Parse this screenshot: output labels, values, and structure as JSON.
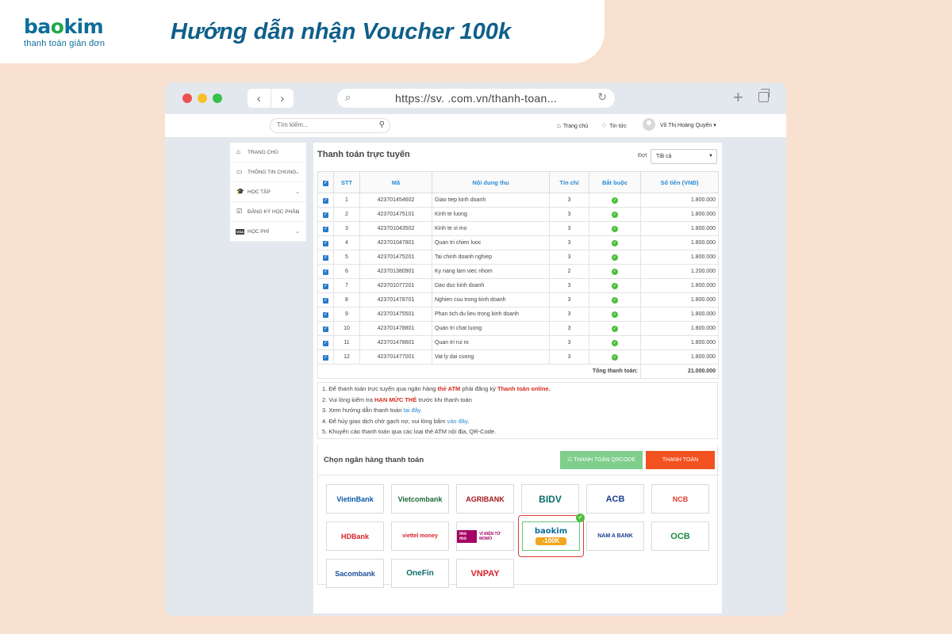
{
  "banner": {
    "logo_main_a": "ba",
    "logo_main_o": "o",
    "logo_main_b": "kim",
    "logo_sub": "thanh toán giản đơn",
    "title": "Hướng dẫn nhận Voucher 100k"
  },
  "browser": {
    "url": "https://sv.        .com.vn/thanh-toan...",
    "back_glyph": "‹",
    "forward_glyph": "›",
    "new_tab_glyph": "+",
    "reload_glyph": "↻",
    "search_glyph": "⌕"
  },
  "topbar": {
    "search_placeholder": "Tìm kiếm...",
    "home_label": "Trang chủ",
    "news_label": "Tin tức",
    "user_name": "Võ Thị Hoàng Quyên ▾"
  },
  "sidebar": {
    "items": [
      {
        "label": "TRANG CHỦ",
        "icon": "home-icon",
        "glyph": "⌂",
        "chevron": ""
      },
      {
        "label": "THÔNG TIN CHUNG",
        "icon": "monitor-icon",
        "glyph": "▭",
        "chevron": "⌄"
      },
      {
        "label": "HỌC TẬP",
        "icon": "graduation-cap-icon",
        "glyph": "🎓",
        "chevron": "⌄"
      },
      {
        "label": "ĐĂNG KÝ HỌC PHẦN",
        "icon": "checkbox-icon",
        "glyph": "☑",
        "chevron": "⌄"
      },
      {
        "label": "HỌC PHÍ",
        "icon": "visa-card-icon",
        "glyph": "VISA",
        "chevron": "⌄"
      }
    ]
  },
  "content": {
    "title": "Thanh toán trực tuyến",
    "filter_label": "Đợt",
    "filter_value": "Tất cả",
    "headers": [
      "STT",
      "Mã",
      "Nội dung thu",
      "Tín chỉ",
      "Bắt buộc",
      "Số tiền (VNĐ)"
    ],
    "rows": [
      {
        "stt": "1",
        "ma": "423701454602",
        "noi_dung": "Giao tiep kinh doanh",
        "tin_chi": "3",
        "so_tien": "1.800.000"
      },
      {
        "stt": "2",
        "ma": "423701475101",
        "noi_dung": "Kinh te luong",
        "tin_chi": "3",
        "so_tien": "1.800.000"
      },
      {
        "stt": "3",
        "ma": "423701043502",
        "noi_dung": "Kinh te vi mo",
        "tin_chi": "3",
        "so_tien": "1.800.000"
      },
      {
        "stt": "4",
        "ma": "423701047801",
        "noi_dung": "Quan tri chien luoc",
        "tin_chi": "3",
        "so_tien": "1.800.000"
      },
      {
        "stt": "5",
        "ma": "423701475201",
        "noi_dung": "Tai chinh doanh nghiep",
        "tin_chi": "3",
        "so_tien": "1.800.000"
      },
      {
        "stt": "6",
        "ma": "423701380901",
        "noi_dung": "Ky nang lam viec nhom",
        "tin_chi": "2",
        "so_tien": "1.200.000"
      },
      {
        "stt": "7",
        "ma": "423701077201",
        "noi_dung": "Dao duc kinh doanh",
        "tin_chi": "3",
        "so_tien": "1.800.000"
      },
      {
        "stt": "8",
        "ma": "423701478701",
        "noi_dung": "Nghien cuu trong kinh doanh",
        "tin_chi": "3",
        "so_tien": "1.800.000"
      },
      {
        "stt": "9",
        "ma": "423701475501",
        "noi_dung": "Phan tich du lieu trong kinh doanh",
        "tin_chi": "3",
        "so_tien": "1.800.000"
      },
      {
        "stt": "10",
        "ma": "423701478801",
        "noi_dung": "Quan tri chat luong",
        "tin_chi": "3",
        "so_tien": "1.800.000"
      },
      {
        "stt": "11",
        "ma": "423701478601",
        "noi_dung": "Quan tri rui ro",
        "tin_chi": "3",
        "so_tien": "1.800.000"
      },
      {
        "stt": "12",
        "ma": "423701477001",
        "noi_dung": "Vat ly dai cuong",
        "tin_chi": "3",
        "so_tien": "1.800.000"
      }
    ],
    "total_label": "Tổng thanh toán:",
    "total_value": "21.000.000",
    "notes": {
      "n1_a": "1. Để thanh toán trực tuyến qua ngân hàng ",
      "n1_b": "thẻ ATM",
      "n1_c": " phải đăng ký ",
      "n1_d": "Thanh toán online.",
      "n2_a": "2. Vui lòng kiểm tra ",
      "n2_b": "HẠN MỨC THẺ",
      "n2_c": " trước khi thanh toán",
      "n3_a": "3. Xem hướng dẫn thanh toán ",
      "n3_b": "tại đây",
      "n4_a": "4. Để hủy giao dịch chờ gạch nợ, vui lòng bấm ",
      "n4_b": "vào đây",
      "n4_c": ".",
      "n5": "5. Khuyến cáo thanh toán qua các loại thẻ ATM nội địa, QR-Code."
    },
    "bank_title": "Chọn ngân hàng thanh toán",
    "btn_qr": "☷ THANH TOÁN QRCODE",
    "btn_pay": "THANH TOÁN",
    "banks": [
      {
        "name": "VietinBank",
        "color": "#0a5aa8"
      },
      {
        "name": "Vietcombank",
        "color": "#1e6b3a"
      },
      {
        "name": "AGRIBANK",
        "color": "#a3151b"
      },
      {
        "name": "BIDV",
        "color": "#0b6d6a"
      },
      {
        "name": "ACB",
        "color": "#1a3d8f"
      },
      {
        "name": "NCB",
        "color": "#e23c2c"
      },
      {
        "name": "HDBank",
        "color": "#d8232a"
      },
      {
        "name": "viettel money",
        "color": "#d8232a"
      },
      {
        "name": "selected",
        "color": "#0d6e9a"
      },
      {
        "name": "NAM A BANK",
        "color": "#1a3d8f"
      },
      {
        "name": "OCB",
        "color": "#1c8a3c"
      },
      {
        "name": "Sacombank",
        "color": "#1b4f9c"
      },
      {
        "name": "OneFin",
        "color": "#0b6d6a"
      },
      {
        "name": "VNPAY",
        "color": "#d8232a"
      }
    ],
    "momo_badge": "mo mo",
    "momo_label": "VÍ ĐIỆN TỬ MOMO",
    "selected_bank": {
      "top": "baokim",
      "pill": "-100K"
    }
  }
}
